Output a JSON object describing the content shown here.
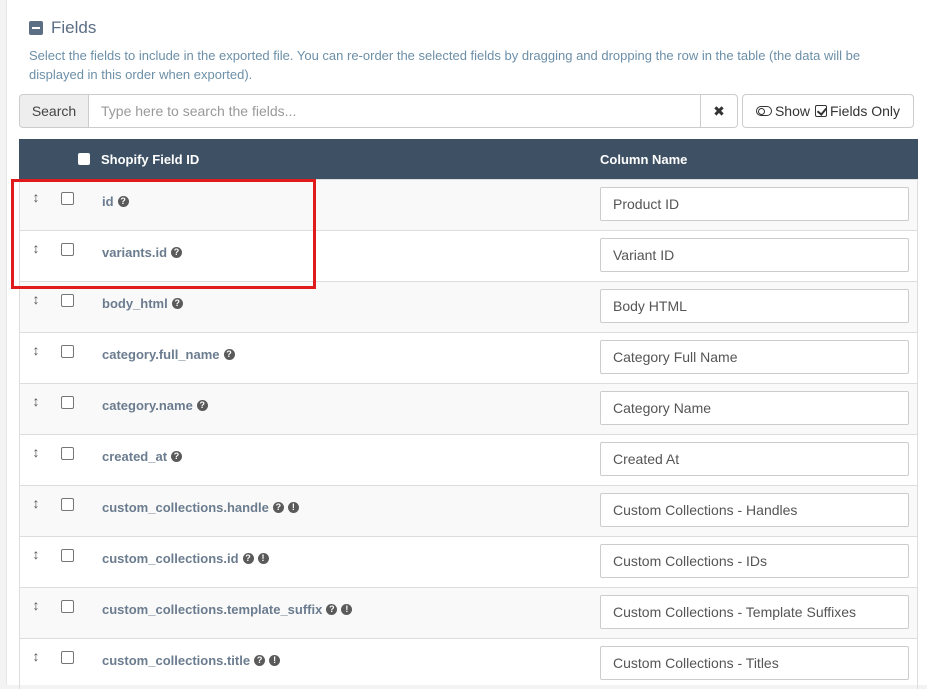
{
  "section": {
    "title": "Fields",
    "description": "Select the fields to include in the exported file. You can re-order the selected fields by dragging and dropping the row in the table (the data will be displayed in this order when exported)."
  },
  "search": {
    "label": "Search",
    "placeholder": "Type here to search the fields...",
    "clear_icon": "times-icon",
    "toggle_show": "Show",
    "toggle_fields_only": "Fields Only"
  },
  "table": {
    "headers": {
      "field": "Shopify Field ID",
      "column": "Column Name"
    },
    "rows": [
      {
        "field": "id",
        "column": "Product ID",
        "warning": false
      },
      {
        "field": "variants.id",
        "column": "Variant ID",
        "warning": false
      },
      {
        "field": "body_html",
        "column": "Body HTML",
        "warning": false
      },
      {
        "field": "category.full_name",
        "column": "Category Full Name",
        "warning": false
      },
      {
        "field": "category.name",
        "column": "Category Name",
        "warning": false
      },
      {
        "field": "created_at",
        "column": "Created At",
        "warning": false
      },
      {
        "field": "custom_collections.handle",
        "column": "Custom Collections - Handles",
        "warning": true
      },
      {
        "field": "custom_collections.id",
        "column": "Custom Collections - IDs",
        "warning": true
      },
      {
        "field": "custom_collections.template_suffix",
        "column": "Custom Collections - Template Suffixes",
        "warning": true
      },
      {
        "field": "custom_collections.title",
        "column": "Custom Collections - Titles",
        "warning": true
      }
    ]
  },
  "colors": {
    "header_bg": "#3e5164",
    "highlight": "#e01b1b",
    "field_text": "#6b7c8f"
  }
}
